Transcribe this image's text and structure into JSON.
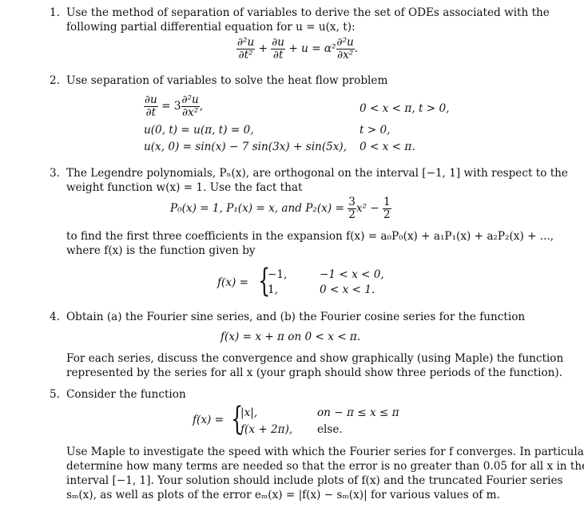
{
  "problems": [
    {
      "number": "1.",
      "lines": [
        "Use the method of separation of variables to derive the set of ODEs associated with the",
        "following partial differential equation for u = u(x, t):"
      ],
      "equation": {
        "t1_num": "∂²u",
        "t1_den": "∂t²",
        "plus1": "+",
        "t2_num": "∂u",
        "t2_den": "∂t",
        "rest": "+ u = α²",
        "t3_num": "∂²u",
        "t3_den": "∂x²",
        "end": "."
      }
    },
    {
      "number": "2.",
      "lines": [
        "Use separation of variables to solve the heat flow problem"
      ],
      "system": {
        "r1_num": "∂u",
        "r1_den": "∂t",
        "r1_mid": "= 3",
        "r1_num2": "∂²u",
        "r1_den2": "∂x²",
        "r1_end": ",",
        "r1_cond": "0 < x < π,    t > 0,",
        "r2": "u(0, t) = u(π, t) = 0,",
        "r2_cond": "t > 0,",
        "r3": "u(x, 0) = sin(x) − 7 sin(3x) + sin(5x),",
        "r3_cond": "0 < x < π."
      }
    },
    {
      "number": "3.",
      "lines": [
        "The Legendre polynomials, Pₙ(x), are orthogonal on the interval [−1, 1] with respect to the",
        "weight function w(x) = 1. Use the fact that"
      ],
      "equation": {
        "left": "P₀(x) = 1,   P₁(x) = x,   and  P₂(x) = ",
        "f1_num": "3",
        "f1_den": "2",
        "mid": "x² −",
        "f2_num": "1",
        "f2_den": "2"
      },
      "after_lines": [
        "to find the first three coefficients in the expansion f(x) = a₀P₀(x) + a₁P₁(x) + a₂P₂(x) + ...,",
        "where f(x) is the function given by"
      ],
      "piecewise": {
        "lhs": "f(x) =",
        "cases": [
          {
            "value": "−1,",
            "condition": "−1 < x < 0,"
          },
          {
            "value": "1,",
            "condition": "0 < x < 1."
          }
        ]
      }
    },
    {
      "number": "4.",
      "lines": [
        "Obtain (a) the Fourier sine series, and (b) the Fourier cosine series for the function"
      ],
      "equation": "f(x) = x + π   on   0 < x < π.",
      "after_lines": [
        "For each series, discuss the convergence and show graphically (using Maple) the function",
        "represented by the series for all x (your graph should show three periods of the function)."
      ]
    },
    {
      "number": "5.",
      "lines": [
        "Consider the function"
      ],
      "piecewise": {
        "lhs": "f(x) =",
        "cases": [
          {
            "value": "|x|,",
            "condition": "on   − π ≤ x ≤ π"
          },
          {
            "value": "f(x + 2π),",
            "condition": "else."
          }
        ]
      },
      "after_lines": [
        "Use Maple to investigate the speed with which the Fourier series for f converges. In particular,",
        "determine how many terms are needed so that the error is no greater than 0.05 for all x in the",
        "interval [−1, 1]. Your solution should include plots of f(x) and the truncated Fourier series",
        "sₘ(x), as well as plots of the error eₘ(x) = |f(x) − sₘ(x)| for various values of m."
      ]
    }
  ]
}
